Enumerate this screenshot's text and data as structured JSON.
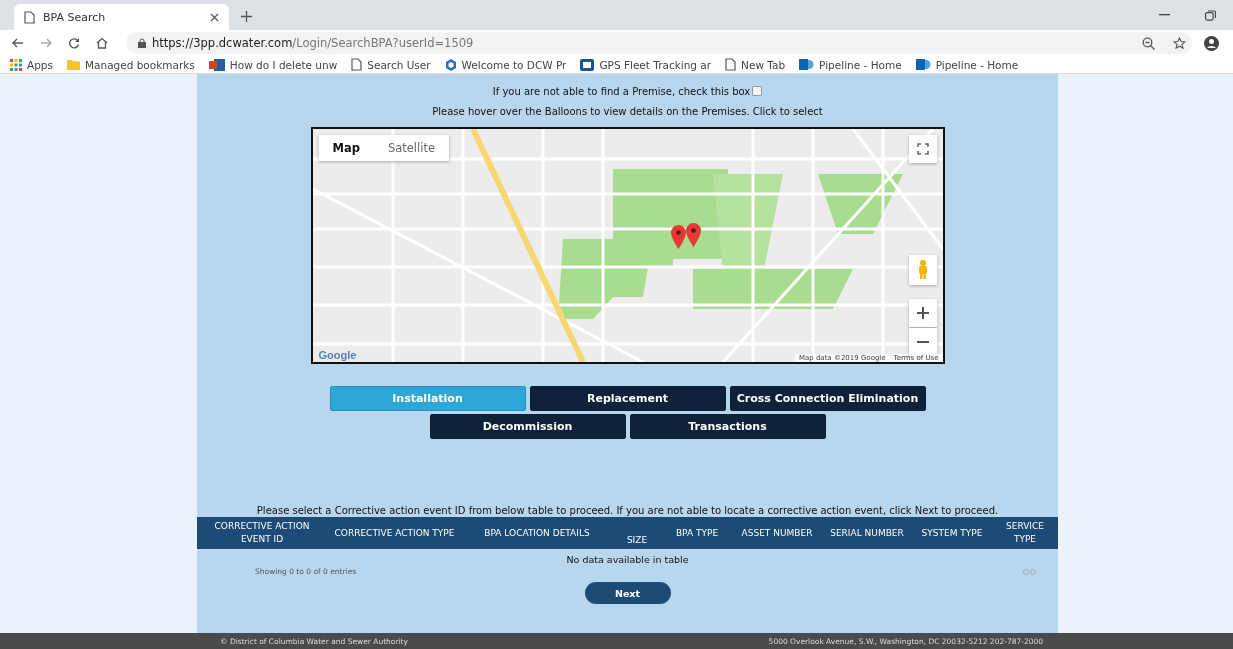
{
  "browser": {
    "tabs": [
      {
        "title": "BPA Search",
        "selected": true
      }
    ],
    "url": {
      "host": "https://3pp.dcwater.com",
      "path": "/Login/SearchBPA?userId=1509"
    },
    "bookmarks": [
      {
        "kind": "apps",
        "label": "Apps"
      },
      {
        "kind": "folder",
        "label": "Managed bookmarks"
      },
      {
        "kind": "exchange",
        "label": "How do I delete unw"
      },
      {
        "kind": "page",
        "label": "Search User"
      },
      {
        "kind": "hex",
        "label": "Welcome to DCW Pr"
      },
      {
        "kind": "gps",
        "label": "GPS Fleet Tracking ar"
      },
      {
        "kind": "page",
        "label": "New Tab"
      },
      {
        "kind": "sharepoint",
        "label": "Pipeline - Home"
      },
      {
        "kind": "sharepoint",
        "label": "Pipeline - Home"
      }
    ]
  },
  "premise_notice": {
    "text": "If you are not able to find a Premise, check this box",
    "checked": false
  },
  "map_hint": "Please hover over the Balloons to view details on the Premises. Click to select",
  "map": {
    "types": [
      {
        "label": "Map",
        "selected": true
      },
      {
        "label": "Satellite",
        "selected": false
      }
    ],
    "attribution": "Map data ©2019 Google",
    "terms": "Terms of Use",
    "logo": "Google"
  },
  "action_buttons": [
    [
      {
        "label": "Installation",
        "selected": true
      },
      {
        "label": "Replacement",
        "selected": false
      },
      {
        "label": "Cross Connection Elimination",
        "selected": false
      }
    ],
    [
      {
        "label": "Decommission",
        "selected": false
      },
      {
        "label": "Transactions",
        "selected": false
      }
    ]
  ],
  "instructions": "Please select a Corrective action event ID from below table to proceed. If you are not able to locate a corrective action event, click Next to proceed.",
  "table": {
    "columns": [
      "CORRECTIVE ACTION EVENT ID",
      "CORRECTIVE ACTION TYPE",
      "BPA LOCATION DETAILS",
      "SIZE",
      "BPA TYPE",
      "ASSET NUMBER",
      "SERIAL NUMBER",
      "SYSTEM TYPE",
      "SERVICE TYPE"
    ],
    "empty_message": "No data available in table",
    "info": "Showing 0 to 0 of 0 entries"
  },
  "next_button": "Next",
  "footer": {
    "left": "© District of Columbia Water and Sewer Authority",
    "right": "5000 Overlook Avenue, S.W., Washington, DC 20032-5212 202-787-2000"
  }
}
